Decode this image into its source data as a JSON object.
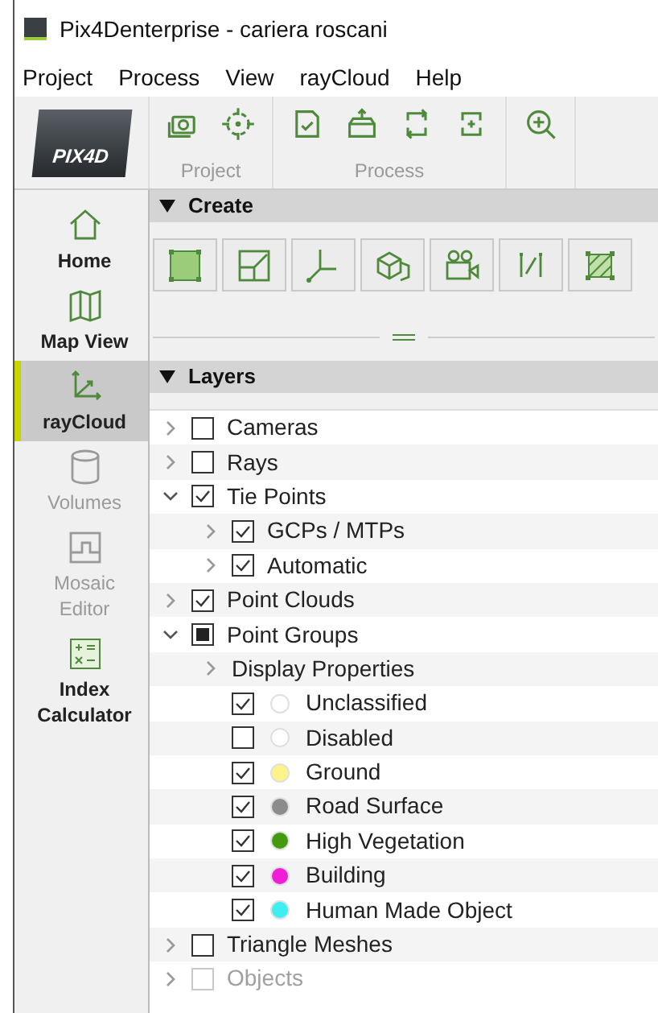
{
  "window": {
    "title": "Pix4Denterprise - cariera roscani"
  },
  "menu": [
    "Project",
    "Process",
    "View",
    "rayCloud",
    "Help"
  ],
  "logo": {
    "text": "PIX4D"
  },
  "toolbar_groups": [
    {
      "label": "Project"
    },
    {
      "label": "Process"
    }
  ],
  "sidebar": [
    {
      "label": "Home",
      "selected": false,
      "disabled": false
    },
    {
      "label": "Map View",
      "selected": false,
      "disabled": false
    },
    {
      "label": "rayCloud",
      "selected": true,
      "disabled": false
    },
    {
      "label": "Volumes",
      "selected": false,
      "disabled": true
    },
    {
      "label": "Mosaic Editor",
      "selected": false,
      "disabled": true
    },
    {
      "label": "Index Calculator",
      "selected": false,
      "disabled": false
    }
  ],
  "create": {
    "title": "Create"
  },
  "layers": {
    "title": "Layers",
    "items": [
      {
        "kind": "layer",
        "label": "Cameras",
        "expanded": false,
        "checked": false,
        "partial": false,
        "disabled": false
      },
      {
        "kind": "layer",
        "label": "Rays",
        "expanded": false,
        "checked": false,
        "partial": false,
        "disabled": false
      },
      {
        "kind": "layer",
        "label": "Tie Points",
        "expanded": true,
        "checked": true,
        "partial": false,
        "disabled": false,
        "children": [
          {
            "kind": "layer",
            "label": "GCPs / MTPs",
            "expanded": false,
            "checked": true,
            "partial": false,
            "disabled": false
          },
          {
            "kind": "layer",
            "label": "Automatic",
            "expanded": false,
            "checked": true,
            "partial": false,
            "disabled": false
          }
        ]
      },
      {
        "kind": "layer",
        "label": "Point Clouds",
        "expanded": false,
        "checked": true,
        "partial": false,
        "disabled": false
      },
      {
        "kind": "layer",
        "label": "Point Groups",
        "expanded": true,
        "checked": false,
        "partial": true,
        "disabled": false,
        "children": [
          {
            "kind": "folder",
            "label": "Display Properties",
            "expanded": false
          },
          {
            "kind": "class",
            "label": "Unclassified",
            "checked": true,
            "color": "#ffffff"
          },
          {
            "kind": "class",
            "label": "Disabled",
            "checked": false,
            "color": "#ffffff"
          },
          {
            "kind": "class",
            "label": "Ground",
            "checked": true,
            "color": "#fff38a"
          },
          {
            "kind": "class",
            "label": "Road Surface",
            "checked": true,
            "color": "#8c8c8c"
          },
          {
            "kind": "class",
            "label": "High Vegetation",
            "checked": true,
            "color": "#449a0e"
          },
          {
            "kind": "class",
            "label": "Building",
            "checked": true,
            "color": "#f01ed6"
          },
          {
            "kind": "class",
            "label": "Human Made Object",
            "checked": true,
            "color": "#3deff0"
          }
        ]
      },
      {
        "kind": "layer",
        "label": "Triangle Meshes",
        "expanded": false,
        "checked": false,
        "partial": false,
        "disabled": false
      },
      {
        "kind": "layer",
        "label": "Objects",
        "expanded": false,
        "checked": false,
        "partial": false,
        "disabled": true
      }
    ]
  }
}
